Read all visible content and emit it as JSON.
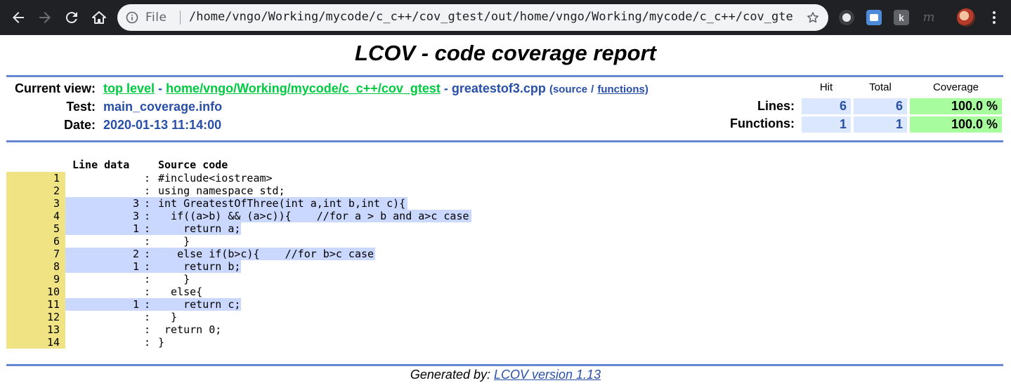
{
  "browser": {
    "file_label": "File",
    "url": "/home/vngo/Working/mycode/c_c++/cov_gtest/out/home/vngo/Working/mycode/c_c++/cov_gte…",
    "ext3_label": "k",
    "ext4_label": "m"
  },
  "page": {
    "title": "LCOV - code coverage report",
    "current_view_label": "Current view:",
    "crumb_top": "top level",
    "crumb_sep1": "-",
    "crumb_dir": "home/vngo/Working/mycode/c_c++/cov_gtest",
    "crumb_sep2": "-",
    "crumb_file": "greatestof3.cpp",
    "source_label": "(source",
    "slash": "/",
    "functions_label": "functions)",
    "test_label": "Test:",
    "test_value": "main_coverage.info",
    "date_label": "Date:",
    "date_value": "2020-01-13 11:14:00"
  },
  "summary": {
    "hit_header": "Hit",
    "total_header": "Total",
    "coverage_header": "Coverage",
    "lines_label": "Lines:",
    "lines_hit": "6",
    "lines_total": "6",
    "lines_coverage": "100.0 %",
    "functions_label": "Functions:",
    "functions_hit": "1",
    "functions_total": "1",
    "functions_coverage": "100.0 %"
  },
  "source": {
    "line_data_header": "Line data",
    "source_code_header": "Source code",
    "rows": [
      {
        "n": "1",
        "count": "",
        "code": "#include<iostream>",
        "hit": false
      },
      {
        "n": "2",
        "count": "",
        "code": "using namespace std;",
        "hit": false
      },
      {
        "n": "3",
        "count": "3",
        "code": "int GreatestOfThree(int a,int b,int c){",
        "hit": true
      },
      {
        "n": "4",
        "count": "3",
        "code": "  if((a>b) && (a>c)){    //for a > b and a>c case",
        "hit": true
      },
      {
        "n": "5",
        "count": "1",
        "code": "    return a;",
        "hit": true
      },
      {
        "n": "6",
        "count": "",
        "code": "    }",
        "hit": false
      },
      {
        "n": "7",
        "count": "2",
        "code": "   else if(b>c){    //for b>c case",
        "hit": true
      },
      {
        "n": "8",
        "count": "1",
        "code": "    return b;",
        "hit": true
      },
      {
        "n": "9",
        "count": "",
        "code": "    }",
        "hit": false
      },
      {
        "n": "10",
        "count": "",
        "code": "  else{",
        "hit": false
      },
      {
        "n": "11",
        "count": "1",
        "code": "    return c;",
        "hit": true
      },
      {
        "n": "12",
        "count": "",
        "code": "  }",
        "hit": false
      },
      {
        "n": "13",
        "count": "",
        "code": " return 0;",
        "hit": false
      },
      {
        "n": "14",
        "count": "",
        "code": "}",
        "hit": false
      }
    ]
  },
  "footer": {
    "generated_by": "Generated by:",
    "lcov_link": "LCOV version 1.13"
  },
  "colors": {
    "accent": "#284fa8",
    "rule": "#6688d4",
    "hit_bg": "#cad7fe",
    "line_no_bg": "#efe383",
    "coverage_high": "#a7fc9d"
  }
}
